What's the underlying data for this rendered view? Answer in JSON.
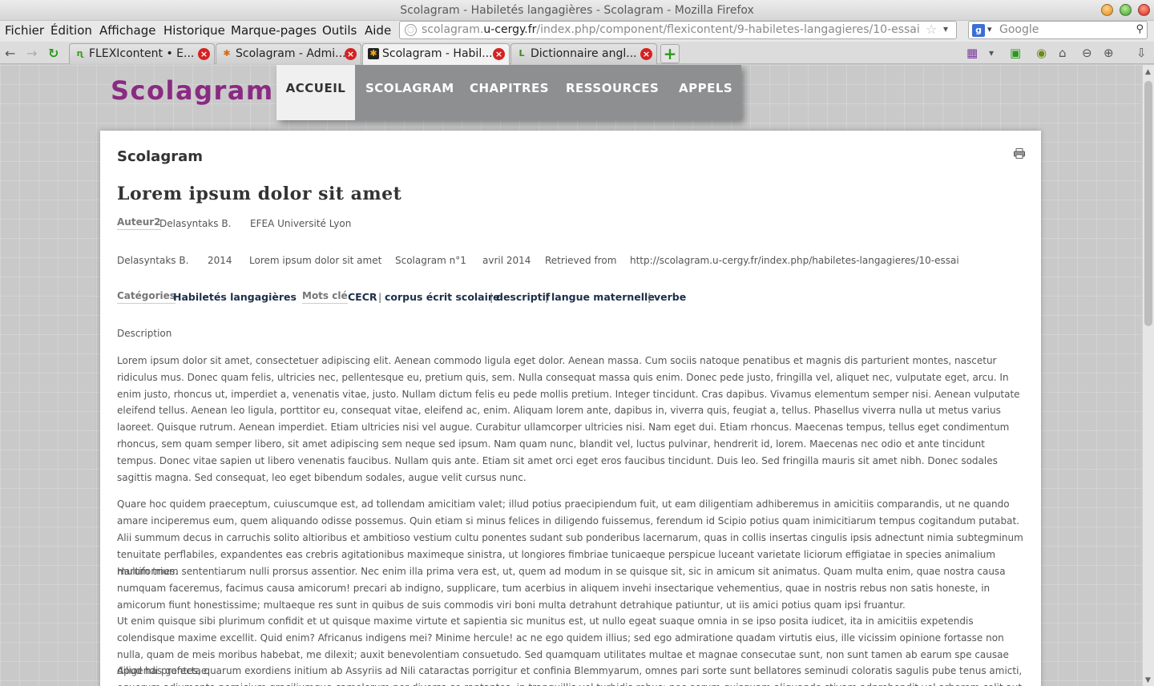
{
  "window": {
    "title": "Scolagram - Habiletés langagières - Scolagram - Mozilla Firefox"
  },
  "menu": [
    "Fichier",
    "Édition",
    "Affichage",
    "Historique",
    "Marque-pages",
    "Outils",
    "Aide"
  ],
  "urlbar": {
    "prefix": "scolagram.",
    "host": "u-cergy.fr",
    "path": "/index.php/component/flexicontent/9-habiletes-langagieres/10-essai"
  },
  "search": {
    "placeholder": "Google"
  },
  "tabs": [
    {
      "label": "FLEXIcontent • E...",
      "active": false
    },
    {
      "label": "Scolagram - Admi...",
      "active": false
    },
    {
      "label": "Scolagram - Habil...",
      "active": true
    },
    {
      "label": "Dictionnaire angl...",
      "active": false
    }
  ],
  "site": {
    "logo": "Scolagram",
    "nav": [
      "ACCUEIL",
      "SCOLAGRAM",
      "CHAPITRES",
      "RESSOURCES",
      "APPELS"
    ]
  },
  "article": {
    "section": "Scolagram",
    "title": "Lorem ipsum dolor sit amet",
    "author_label": "Auteur2",
    "author_name": "Delasyntaks B.",
    "author_affiliation": "EFEA Université Lyon",
    "citation": [
      "Delasyntaks B.",
      "2014",
      "Lorem ipsum dolor sit amet",
      "Scolagram n°1",
      "avril 2014",
      "Retrieved from",
      "http://scolagram.u-cergy.fr/index.php/habiletes-langagieres/10-essai"
    ],
    "categories_label": "Catégories",
    "category": "Habiletés langagières",
    "keywords_label": "Mots clé",
    "keywords": [
      "CECR",
      "corpus écrit scolaire",
      "descriptif",
      "langue maternelle",
      "verbe"
    ],
    "keyword_separator": "|",
    "description_label": "Description",
    "paragraphs": [
      "Lorem ipsum dolor sit amet, consectetuer adipiscing elit. Aenean commodo ligula eget dolor. Aenean massa. Cum sociis natoque penatibus et magnis dis parturient montes, nascetur ridiculus mus. Donec quam felis, ultricies nec, pellentesque eu, pretium quis, sem. Nulla consequat massa quis enim. Donec pede justo, fringilla vel, aliquet nec, vulputate eget, arcu. In enim justo, rhoncus ut, imperdiet a, venenatis vitae, justo. Nullam dictum felis eu pede mollis pretium. Integer tincidunt. Cras dapibus. Vivamus elementum semper nisi. Aenean vulputate eleifend tellus. Aenean leo ligula, porttitor eu, consequat vitae, eleifend ac, enim. Aliquam lorem ante, dapibus in, viverra quis, feugiat a, tellus. Phasellus viverra nulla ut metus varius laoreet. Quisque rutrum. Aenean imperdiet. Etiam ultricies nisi vel augue. Curabitur ullamcorper ultricies nisi. Nam eget dui. Etiam rhoncus. Maecenas tempus, tellus eget condimentum rhoncus, sem quam semper libero, sit amet adipiscing sem neque sed ipsum. Nam quam nunc, blandit vel, luctus pulvinar, hendrerit id, lorem. Maecenas nec odio et ante tincidunt tempus. Donec vitae sapien ut libero venenatis faucibus. Nullam quis ante. Etiam sit amet orci eget eros faucibus tincidunt. Duis leo. Sed fringilla mauris sit amet nibh. Donec sodales sagittis magna. Sed consequat, leo eget bibendum sodales, augue velit cursus nunc.",
      "Quare hoc quidem praeceptum, cuiuscumque est, ad tollendam amicitiam valet; illud potius praecipiendum fuit, ut eam diligentiam adhiberemus in amicitiis comparandis, ut ne quando amare inciperemus eum, quem aliquando odisse possemus. Quin etiam si minus felices in diligendo fuissemus, ferendum id Scipio potius quam inimicitiarum tempus cogitandum putabat.",
      "Alii summum decus in carruchis solito altioribus et ambitioso vestium cultu ponentes sudant sub ponderibus lacernarum, quas in collis insertas cingulis ipsis adnectunt nimia subtegminum tenuitate perflabiles, expandentes eas crebris agitationibus maximeque sinistra, ut longiores fimbriae tunicaeque perspicue luceant varietate liciorum effigiatae in species animalium multiformes.",
      "Harum trium sententiarum nulli prorsus assentior. Nec enim illa prima vera est, ut, quem ad modum in se quisque sit, sic in amicum sit animatus. Quam multa enim, quae nostra causa numquam faceremus, facimus causa amicorum! precari ab indigno, supplicare, tum acerbius in aliquem invehi insectarique vehementius, quae in nostris rebus non satis honeste, in amicorum fiunt honestissime; multaeque res sunt in quibus de suis commodis viri boni multa detrahunt detrahique patiuntur, ut iis amici potius quam ipsi fruantur.",
      "Ut enim quisque sibi plurimum confidit et ut quisque maxime virtute et sapientia sic munitus est, ut nullo egeat suaque omnia in se ipso posita iudicet, ita in amicitiis expetendis colendisque maxime excellit. Quid enim? Africanus indigens mei? Minime hercule! ac ne ego quidem illius; sed ego admiratione quadam virtutis eius, ille vicissim opinione fortasse non nulla, quam de meis moribus habebat, me dilexit; auxit benevolentiam consuetudo. Sed quamquam utilitates multae et magnae consecutae sunt, non sunt tamen ab earum spe causae diligendi profectae.",
      "Apud has gentes, quarum exordiens initium ab Assyriis ad Nili cataractas porrigitur et confinia Blemmyarum, omnes pari sorte sunt bellatores seminudi coloratis sagulis pube tenus amicti, equorum adiumento pernicium graciliumque camelorum per diversa se raptantes, in tranquillis vel turbidis rebus: nec eorum quisquam aliquando stivam adprehendit vel arborem colit aut arva"
    ]
  }
}
